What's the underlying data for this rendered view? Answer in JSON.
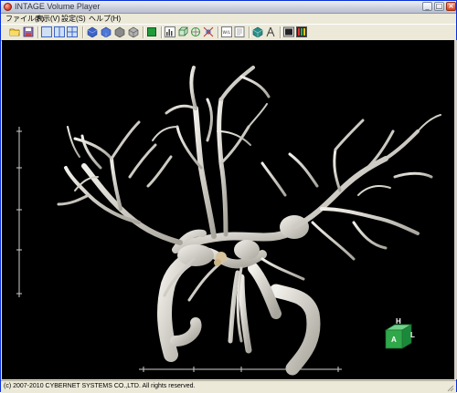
{
  "window": {
    "title": "INTAGE Volume Player",
    "controls": {
      "minimize": "_",
      "maximize": "□",
      "close": "×"
    }
  },
  "menu": [
    {
      "label": "ファイル(F)"
    },
    {
      "label": "表示(V)"
    },
    {
      "label": "設定(S)"
    },
    {
      "label": "ヘルプ(H)"
    }
  ],
  "toolbar": {
    "icons": [
      "open-folder-icon",
      "save-icon",
      "layout-single-icon",
      "layout-dual-icon",
      "layout-quad-icon",
      "volume-cube-blue-icon",
      "volume-cube-blue2-icon",
      "volume-cube-gray-icon",
      "volume-cube-dark-icon",
      "green-square-icon",
      "histogram-icon",
      "cube-outline-icon",
      "rotate-axes-icon",
      "crosshair-icon",
      "window-level-icon",
      "slice-icon",
      "color-cube-icon",
      "measure-icon",
      "screenshot-icon",
      "color-palette-icon"
    ],
    "accent_blue": "#3d64c8",
    "accent_green": "#1f9b3a"
  },
  "viewport": {
    "background": "#000000",
    "vessel_color": "#d9d6cc",
    "orientation_cube": {
      "top": "H",
      "front": "A",
      "side": "L",
      "color": "#2fa84a"
    }
  },
  "status": {
    "copyright": "(c) 2007-2010 CYBERNET SYSTEMS CO.,LTD. All rights reserved."
  }
}
